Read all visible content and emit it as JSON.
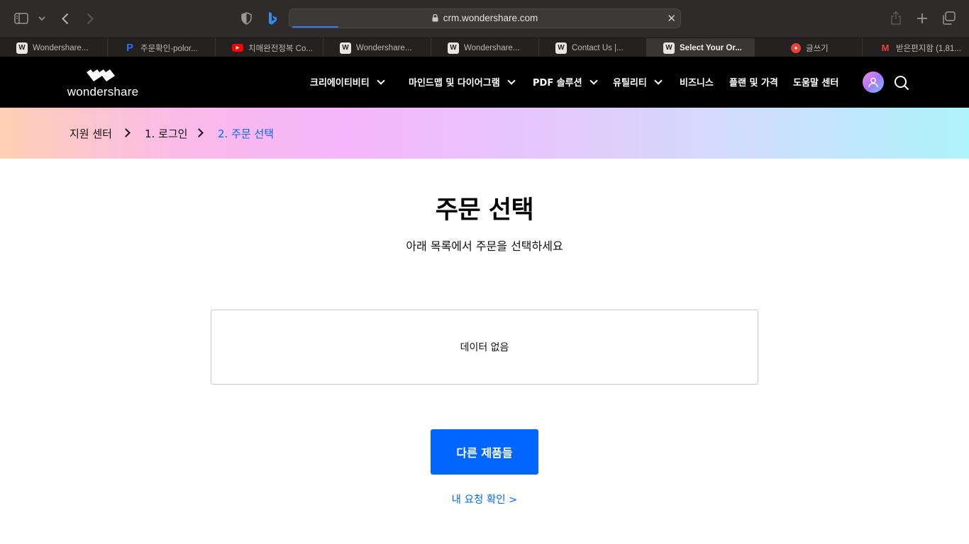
{
  "browser": {
    "url": "crm.wondershare.com",
    "load_progress": 0.12,
    "tabs": [
      {
        "label": "Wondershare...",
        "favicon": "wondershare-icon",
        "active": false
      },
      {
        "label": "주문확인-polor...",
        "favicon": "polor-icon",
        "active": false
      },
      {
        "label": "치매완전정복 Co...",
        "favicon": "youtube-icon",
        "active": false
      },
      {
        "label": "Wondershare...",
        "favicon": "wondershare-icon",
        "active": false
      },
      {
        "label": "Wondershare...",
        "favicon": "wondershare-icon",
        "active": false
      },
      {
        "label": "Contact Us |...",
        "favicon": "wondershare-icon",
        "active": false
      },
      {
        "label": "Select Your Or...",
        "favicon": "wondershare-icon",
        "active": true
      },
      {
        "label": "글쓰기",
        "favicon": "write-icon",
        "active": false
      },
      {
        "label": "받은편지함 (1,81...",
        "favicon": "gmail-icon",
        "active": false
      }
    ]
  },
  "header": {
    "logo_text": "wondershare",
    "nav": [
      {
        "label": "크리에이티비티",
        "has_dropdown": true
      },
      {
        "label": "마인드맵 및 다이어그램",
        "has_dropdown": true
      },
      {
        "label": "PDF 솔루션",
        "has_dropdown": true
      },
      {
        "label": "유틸리티",
        "has_dropdown": true
      },
      {
        "label": "비즈니스",
        "has_dropdown": false
      },
      {
        "label": "플랜 및 가격",
        "has_dropdown": false
      },
      {
        "label": "도움말 센터",
        "has_dropdown": false
      }
    ]
  },
  "breadcrumb": {
    "items": [
      "지원 센터",
      "1. 로그인",
      "2. 주문 선택"
    ],
    "current_index": 2
  },
  "main": {
    "title": "주문 선택",
    "subtitle": "아래 목록에서 주문을 선택하세요",
    "empty_text": "데이터 없음",
    "other_products_button": "다른 제품들",
    "my_requests_link": "내 요청 확인 >"
  },
  "colors": {
    "accent": "#0066ff",
    "header_bg": "#000000",
    "toolbar_bg": "#2f2b2a"
  }
}
